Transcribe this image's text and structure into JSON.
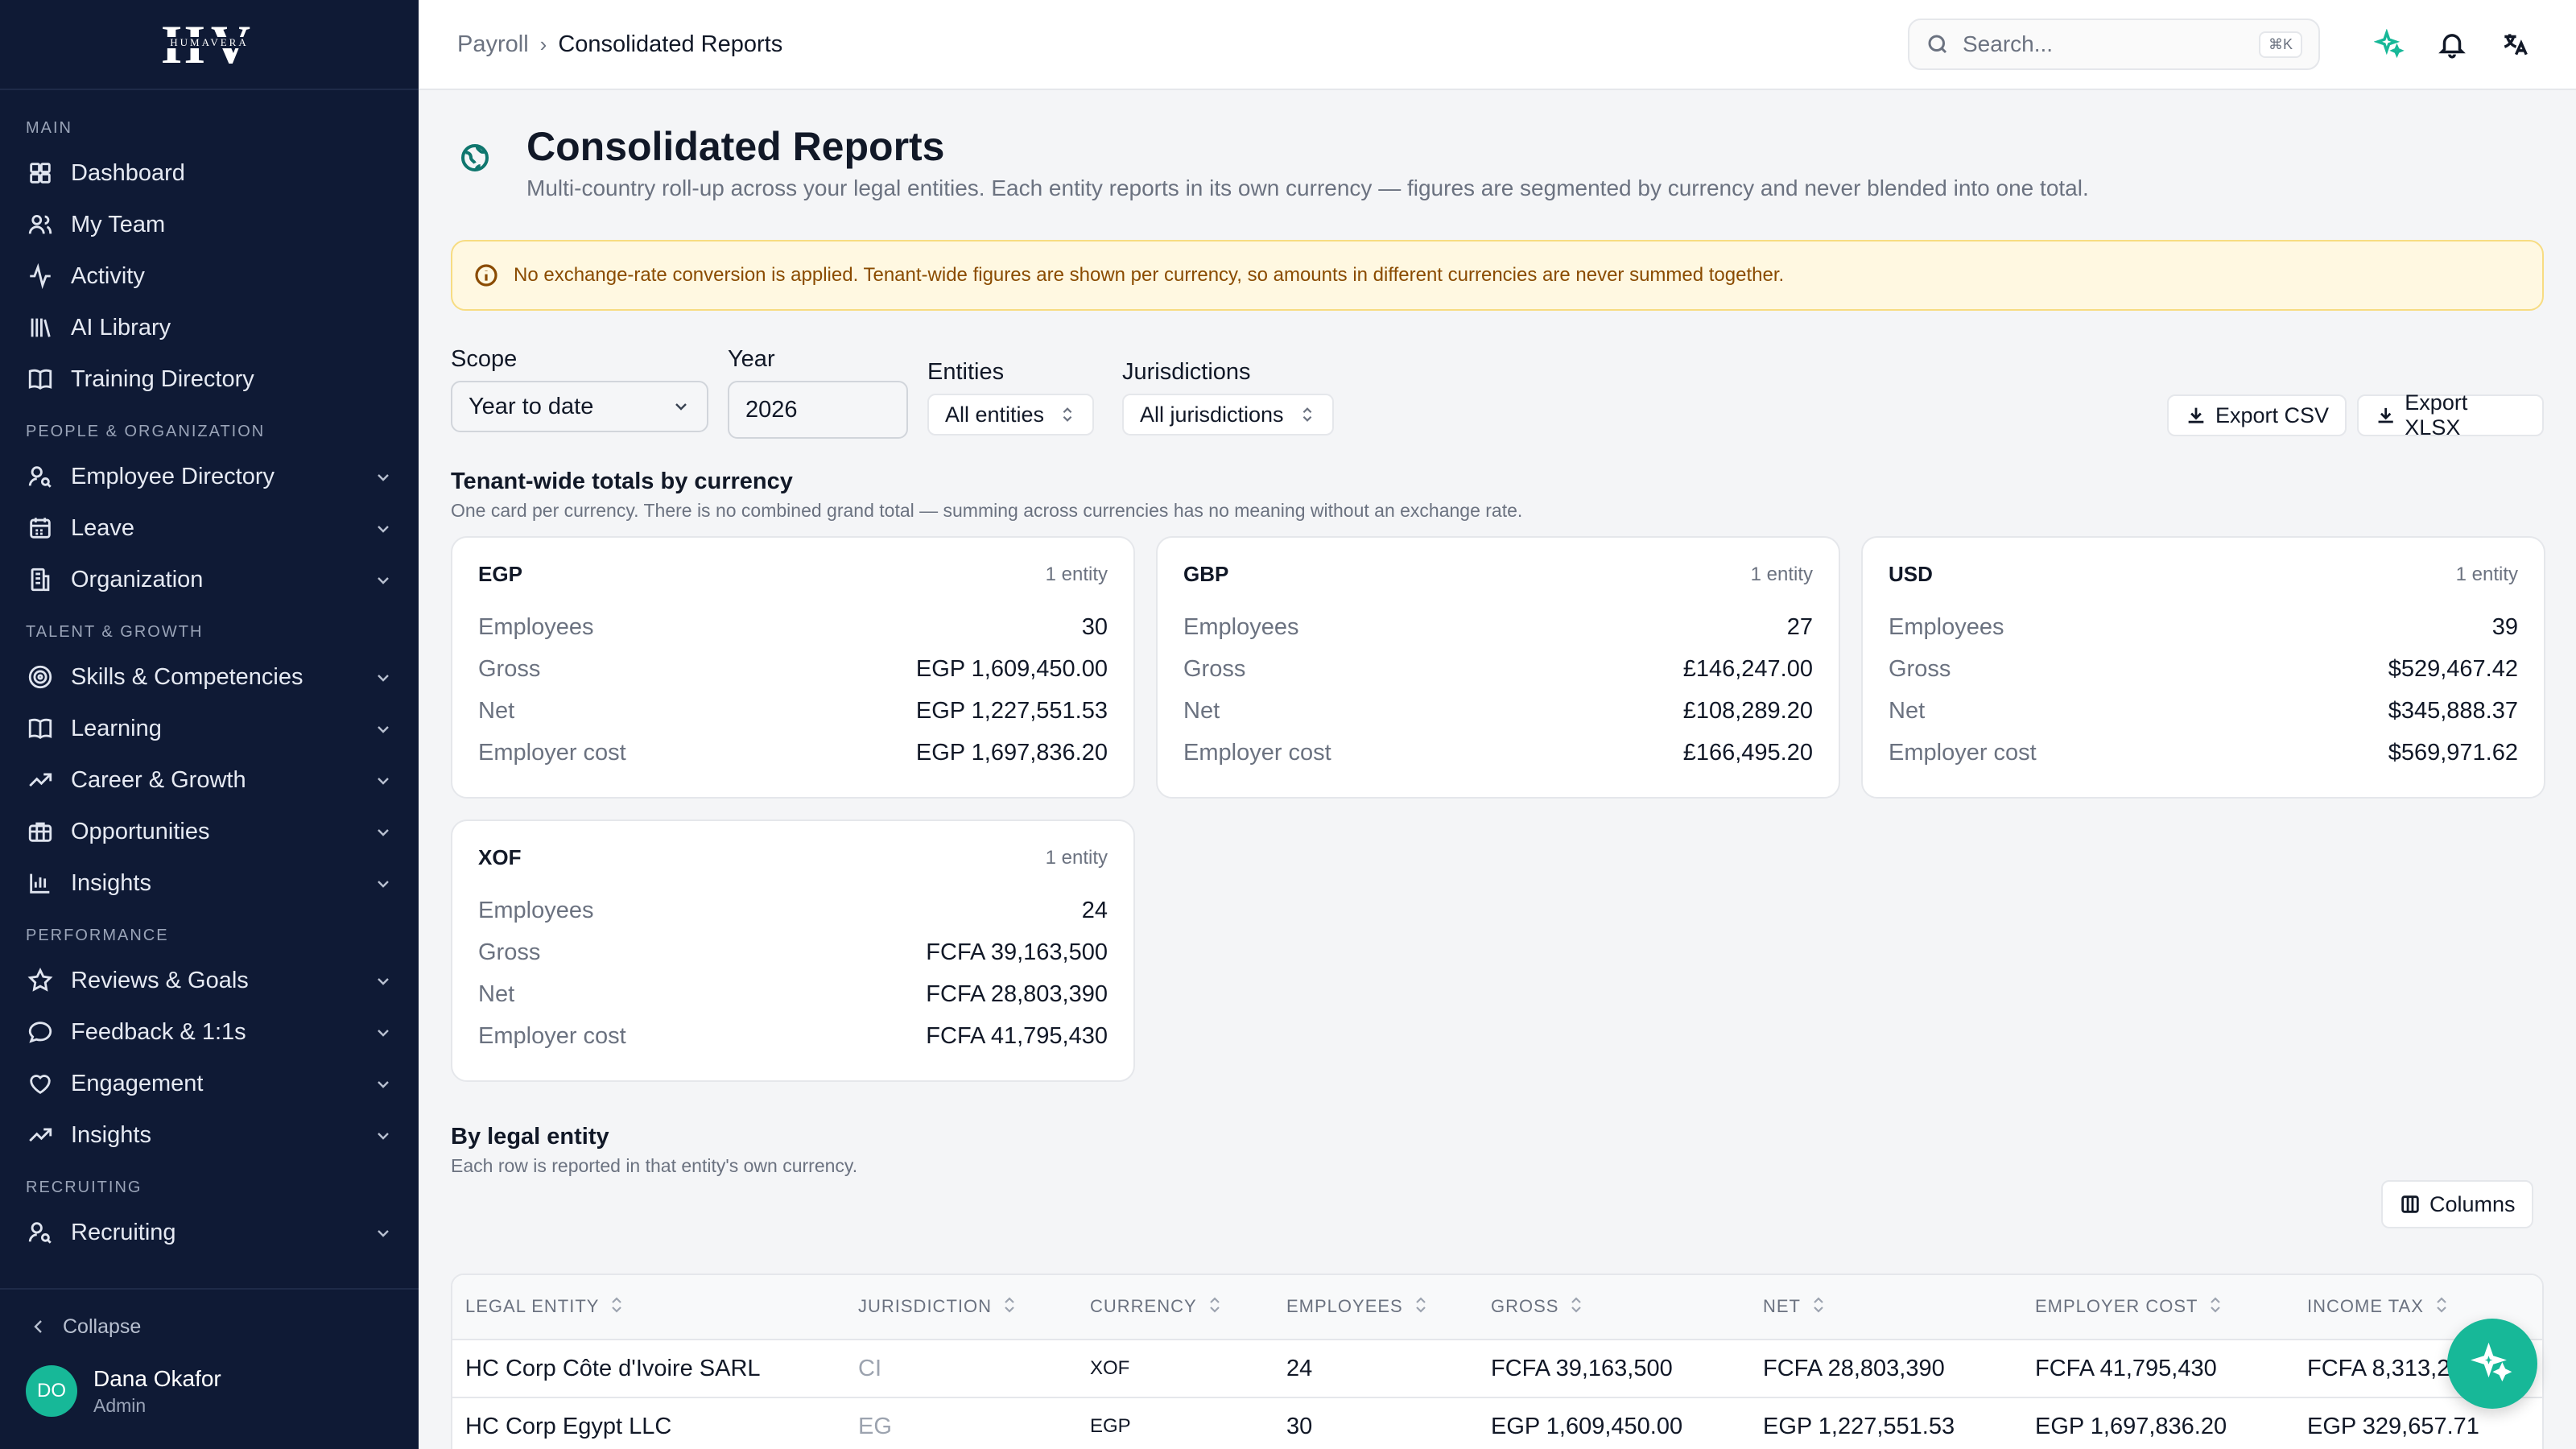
{
  "brand": {
    "logo_text": "HV",
    "logo_sub": "HUMAVERA"
  },
  "sidebar": {
    "sections": [
      {
        "title": "MAIN",
        "items": [
          {
            "label": "Dashboard",
            "icon": "dashboard-icon",
            "expandable": false
          },
          {
            "label": "My Team",
            "icon": "team-icon",
            "expandable": false
          },
          {
            "label": "Activity",
            "icon": "activity-icon",
            "expandable": false
          },
          {
            "label": "AI Library",
            "icon": "library-icon",
            "expandable": false
          },
          {
            "label": "Training Directory",
            "icon": "book-icon",
            "expandable": false
          }
        ]
      },
      {
        "title": "PEOPLE & ORGANIZATION",
        "items": [
          {
            "label": "Employee Directory",
            "icon": "user-search-icon",
            "expandable": true
          },
          {
            "label": "Leave",
            "icon": "calendar-icon",
            "expandable": true
          },
          {
            "label": "Organization",
            "icon": "building-icon",
            "expandable": true
          }
        ]
      },
      {
        "title": "TALENT & GROWTH",
        "items": [
          {
            "label": "Skills & Competencies",
            "icon": "target-icon",
            "expandable": true
          },
          {
            "label": "Learning",
            "icon": "book-icon",
            "expandable": true
          },
          {
            "label": "Career & Growth",
            "icon": "trending-up-icon",
            "expandable": true
          },
          {
            "label": "Opportunities",
            "icon": "briefcase-icon",
            "expandable": true
          },
          {
            "label": "Insights",
            "icon": "bar-chart-icon",
            "expandable": true
          }
        ]
      },
      {
        "title": "PERFORMANCE",
        "items": [
          {
            "label": "Reviews & Goals",
            "icon": "star-icon",
            "expandable": true
          },
          {
            "label": "Feedback & 1:1s",
            "icon": "message-icon",
            "expandable": true
          },
          {
            "label": "Engagement",
            "icon": "heart-icon",
            "expandable": true
          },
          {
            "label": "Insights",
            "icon": "trending-up-icon",
            "expandable": true
          }
        ]
      },
      {
        "title": "RECRUITING",
        "items": [
          {
            "label": "Recruiting",
            "icon": "user-search-icon",
            "expandable": true
          }
        ]
      }
    ],
    "collapse_label": "Collapse",
    "user": {
      "initials": "DO",
      "name": "Dana Okafor",
      "role": "Admin"
    }
  },
  "topbar": {
    "breadcrumb": {
      "parent": "Payroll",
      "current": "Consolidated Reports"
    },
    "search_placeholder": "Search...",
    "search_shortcut": "⌘K"
  },
  "page": {
    "title": "Consolidated Reports",
    "subtitle": "Multi-country roll-up across your legal entities. Each entity reports in its own currency — figures are segmented by currency and never blended into one total.",
    "alert": "No exchange-rate conversion is applied. Tenant-wide figures are shown per currency, so amounts in different currencies are never summed together."
  },
  "filters": {
    "scope_label": "Scope",
    "scope_value": "Year to date",
    "year_label": "Year",
    "year_value": "2026",
    "entities_label": "Entities",
    "entities_value": "All entities",
    "jurisdictions_label": "Jurisdictions",
    "jurisdictions_value": "All jurisdictions",
    "export_csv": "Export CSV",
    "export_xlsx": "Export XLSX"
  },
  "totals": {
    "title": "Tenant-wide totals by currency",
    "subtitle": "One card per currency. There is no combined grand total — summing across currencies has no meaning without an exchange rate.",
    "row_labels": {
      "employees": "Employees",
      "gross": "Gross",
      "net": "Net",
      "employer_cost": "Employer cost"
    },
    "cards": [
      {
        "currency": "EGP",
        "entities": "1 entity",
        "employees": "30",
        "gross": "EGP 1,609,450.00",
        "net": "EGP 1,227,551.53",
        "employer_cost": "EGP 1,697,836.20"
      },
      {
        "currency": "GBP",
        "entities": "1 entity",
        "employees": "27",
        "gross": "£146,247.00",
        "net": "£108,289.20",
        "employer_cost": "£166,495.20"
      },
      {
        "currency": "USD",
        "entities": "1 entity",
        "employees": "39",
        "gross": "$529,467.42",
        "net": "$345,888.37",
        "employer_cost": "$569,971.62"
      },
      {
        "currency": "XOF",
        "entities": "1 entity",
        "employees": "24",
        "gross": "FCFA 39,163,500",
        "net": "FCFA 28,803,390",
        "employer_cost": "FCFA 41,795,430"
      }
    ]
  },
  "by_entity": {
    "title": "By legal entity",
    "subtitle": "Each row is reported in that entity's own currency.",
    "columns_button": "Columns",
    "headers": [
      "LEGAL ENTITY",
      "JURISDICTION",
      "CURRENCY",
      "EMPLOYEES",
      "GROSS",
      "NET",
      "EMPLOYER COST",
      "INCOME TAX"
    ],
    "rows": [
      [
        "HC Corp Côte d'Ivoire SARL",
        "CI",
        "XOF",
        "24",
        "FCFA 39,163,500",
        "FCFA 28,803,390",
        "FCFA 41,795,430",
        "FCFA 8,313,2"
      ],
      [
        "HC Corp Egypt LLC",
        "EG",
        "EGP",
        "30",
        "EGP 1,609,450.00",
        "EGP 1,227,551.53",
        "EGP 1,697,836.20",
        "EGP 329,657.71"
      ]
    ]
  },
  "colors": {
    "sidebar_bg": "#0f1a35",
    "accent": "#17b898",
    "alert_bg": "#fff8e1",
    "alert_text": "#8a4b00"
  }
}
